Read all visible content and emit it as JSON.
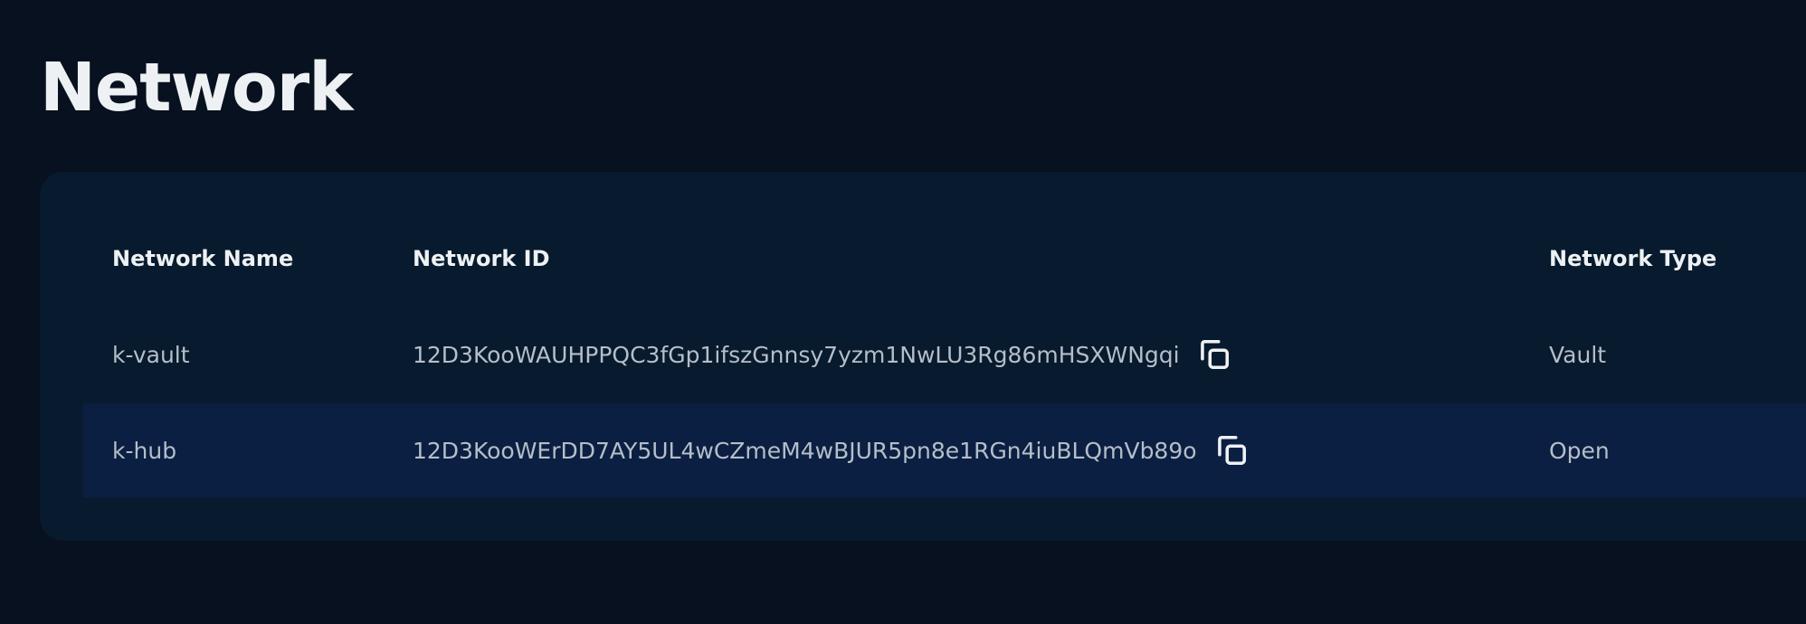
{
  "page": {
    "title": "Network"
  },
  "table": {
    "columns": [
      "Network Name",
      "Network ID",
      "Network Type"
    ],
    "rows": [
      {
        "name": "k-vault",
        "id": "12D3KooWAUHPPQC3fGp1ifszGnnsy7yzm1NwLU3Rg86mHSXWNgqi",
        "type": "Vault",
        "copy_icon": "copy-icon"
      },
      {
        "name": "k-hub",
        "id": "12D3KooWErDD7AY5UL4wCZmeM4wBJUR5pn8e1RGn4iuBLQmVb89o",
        "type": "Open",
        "copy_icon": "copy-icon"
      }
    ]
  },
  "colors": {
    "background": "#07111f",
    "card": "#081a2d",
    "highlight_row": "#0b1f42",
    "heading_text": "#eef1f4",
    "cell_text": "#b5bec9"
  }
}
